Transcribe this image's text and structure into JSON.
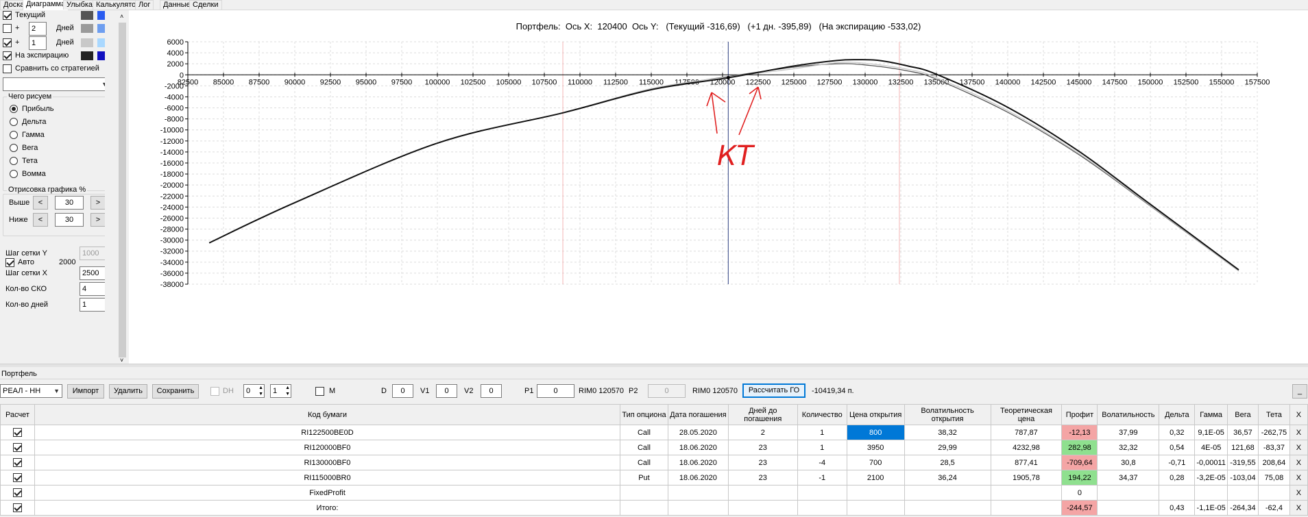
{
  "tabs": [
    "Доска",
    "Диаграмма",
    "Улыбка",
    "Калькулятор",
    "Лог",
    "Данные",
    "Сделки"
  ],
  "active_tab": 1,
  "left_panel": {
    "current": {
      "label": "Текущий",
      "checked": true,
      "color_dark": "#555555",
      "color_light": "#2a5cf0"
    },
    "plus_days_1": {
      "sign": "+",
      "value": "2",
      "unit": "Дней",
      "checked": false,
      "color_dark": "#9a9a9a",
      "color_light": "#6e9ef0"
    },
    "plus_days_2": {
      "sign": "+",
      "value": "1",
      "unit": "Дней",
      "checked": true,
      "color_dark": "#c8c8c8",
      "color_light": "#a9d8ff"
    },
    "expiry": {
      "label": "На экспирацию",
      "checked": true,
      "color_dark": "#222222",
      "color_light": "#1010c0"
    },
    "compare": {
      "label": "Сравнить со стратегией",
      "checked": false
    },
    "strategy_select": "",
    "what_draw": {
      "title": "Чего рисуем",
      "options": [
        "Прибыль",
        "Дельта",
        "Гамма",
        "Вега",
        "Тета",
        "Вомма"
      ],
      "selected": 0
    },
    "draw_pct": {
      "title": "Отрисовка графика %",
      "above_label": "Выше",
      "above_value": "30",
      "below_label": "Ниже",
      "below_value": "30",
      "prev": "<",
      "next": ">"
    },
    "grid_y": {
      "label": "Шаг сетки Y",
      "value": "1000"
    },
    "auto": {
      "label": "Авто",
      "checked": true,
      "value": "2000"
    },
    "grid_x": {
      "label": "Шаг сетки X",
      "value": "2500"
    },
    "sko": {
      "label": "Кол-во СКО",
      "value": "4"
    },
    "days": {
      "label": "Кол-во дней",
      "value": "1"
    }
  },
  "chart": {
    "title": "Портфель:  Ось X:  120400  Ось Y:   (Текущий -316,69)   (+1 дн. -395,89)   (На экспирацию -533,02)",
    "annotation": "КТ"
  },
  "chart_data": {
    "type": "line",
    "title": "Портфель:  Ось X:  120400  Ось Y:   (Текущий -316,69)   (+1 дн. -395,89)   (На экспирацию -533,02)",
    "xlabel": "",
    "ylabel": "",
    "xlim": [
      82500,
      157500
    ],
    "ylim": [
      -38000,
      6000
    ],
    "x_ticks": [
      82500,
      85000,
      87500,
      90000,
      92500,
      95000,
      97500,
      100000,
      102500,
      105000,
      107500,
      110000,
      112500,
      115000,
      117500,
      120000,
      122500,
      125000,
      127500,
      130000,
      132500,
      135000,
      137500,
      140000,
      142500,
      145000,
      147500,
      150000,
      152500,
      155000,
      157500
    ],
    "y_ticks": [
      6000,
      4000,
      2000,
      0,
      -2000,
      -4000,
      -6000,
      -8000,
      -10000,
      -12000,
      -14000,
      -16000,
      -18000,
      -20000,
      -22000,
      -24000,
      -26000,
      -28000,
      -30000,
      -32000,
      -34000,
      -36000,
      -38000
    ],
    "grid": true,
    "vertical_markers": [
      {
        "x": 108800,
        "color": "#f4b6b6"
      },
      {
        "x": 120400,
        "color": "#2c3e80"
      },
      {
        "x": 132400,
        "color": "#f4b6b6"
      }
    ],
    "series": [
      {
        "name": "Текущий",
        "color": "#555555",
        "x": [
          84000,
          90000,
          100000,
          108800,
          115000,
          120400,
          125000,
          128000,
          130000,
          133000,
          135000,
          140000,
          145000,
          150000,
          156200
        ],
        "y": [
          -30500,
          -23200,
          -12400,
          -6900,
          -2600,
          -317,
          1400,
          2000,
          1800,
          700,
          -800,
          -6800,
          -14500,
          -23800,
          -35600
        ]
      },
      {
        "name": "+1 дн.",
        "color": "#c8c8c8",
        "x": [
          84000,
          90000,
          100000,
          108800,
          115000,
          120400,
          125000,
          128000,
          130000,
          133000,
          135000,
          140000,
          145000,
          150000,
          156200
        ],
        "y": [
          -30500,
          -23200,
          -12400,
          -6900,
          -2500,
          -396,
          1100,
          2200,
          2100,
          1000,
          -500,
          -6500,
          -14300,
          -23700,
          -35600
        ]
      },
      {
        "name": "На экспирацию",
        "color": "#111111",
        "x": [
          84000,
          90000,
          100000,
          108800,
          115000,
          120400,
          125000,
          128000,
          129500,
          131000,
          133000,
          135000,
          140000,
          145000,
          150000,
          156200
        ],
        "y": [
          -30500,
          -23200,
          -12400,
          -6900,
          -2700,
          -533,
          1600,
          2600,
          2750,
          2600,
          1600,
          100,
          -5900,
          -13900,
          -23500,
          -35400
        ]
      }
    ]
  },
  "bottom": {
    "group_label": "Портфель",
    "portfolio_select": "РЕАЛ - НН",
    "import_btn": "Импорт",
    "delete_btn": "Удалить",
    "save_btn": "Сохранить",
    "dh_label": "DH",
    "spin1": "0",
    "spin2": "1",
    "m_label": "M",
    "d_label": "D",
    "d_value": "0",
    "v1_label": "V1",
    "v1_value": "0",
    "v2_label": "V2",
    "v2_value": "0",
    "p1_label": "P1",
    "p1_value": "0",
    "rim1": "RIM0 120570",
    "p2_label": "P2",
    "p2_value": "0",
    "rim2": "RIM0 120570",
    "go_btn": "Рассчитать ГО",
    "go_value": "-10419,34 п.",
    "min_btn": "_"
  },
  "table": {
    "headers": [
      "Расчет",
      "Код бумаги",
      "Тип опциона",
      "Дата погашения",
      "Дней до погашения",
      "Количество",
      "Цена открытия",
      "Волатильность открытия",
      "Теоретическая цена",
      "Профит",
      "Волатильность",
      "Дельта",
      "Гамма",
      "Вега",
      "Тета",
      "X"
    ],
    "rows": [
      {
        "checked": true,
        "code": "RI122500BE0D",
        "type": "Call",
        "date": "28.05.2020",
        "days": "2",
        "qty": "1",
        "open_price": "800",
        "open_vol": "38,32",
        "theo": "787,87",
        "profit": "-12,13",
        "vol": "37,99",
        "delta": "0,32",
        "gamma": "9,1E-05",
        "vega": "36,57",
        "theta": "-262,75",
        "x": "X"
      },
      {
        "checked": true,
        "code": "RI120000BF0",
        "type": "Call",
        "date": "18.06.2020",
        "days": "23",
        "qty": "1",
        "open_price": "3950",
        "open_vol": "29,99",
        "theo": "4232,98",
        "profit": "282,98",
        "vol": "32,32",
        "delta": "0,54",
        "gamma": "4E-05",
        "vega": "121,68",
        "theta": "-83,37",
        "x": "X"
      },
      {
        "checked": true,
        "code": "RI130000BF0",
        "type": "Call",
        "date": "18.06.2020",
        "days": "23",
        "qty": "-4",
        "open_price": "700",
        "open_vol": "28,5",
        "theo": "877,41",
        "profit": "-709,64",
        "vol": "30,8",
        "delta": "-0,71",
        "gamma": "-0,00011",
        "vega": "-319,55",
        "theta": "208,64",
        "x": "X"
      },
      {
        "checked": true,
        "code": "RI115000BR0",
        "type": "Put",
        "date": "18.06.2020",
        "days": "23",
        "qty": "-1",
        "open_price": "2100",
        "open_vol": "36,24",
        "theo": "1905,78",
        "profit": "194,22",
        "vol": "34,37",
        "delta": "0,28",
        "gamma": "-3,2E-05",
        "vega": "-103,04",
        "theta": "75,08",
        "x": "X"
      },
      {
        "checked": true,
        "code": "FixedProfit",
        "type": "",
        "date": "",
        "days": "",
        "qty": "",
        "open_price": "",
        "open_vol": "",
        "theo": "",
        "profit": "0",
        "vol": "",
        "delta": "",
        "gamma": "",
        "vega": "",
        "theta": "",
        "x": "X"
      },
      {
        "checked": true,
        "code": "Итого:",
        "type": "",
        "date": "",
        "days": "",
        "qty": "",
        "open_price": "",
        "open_vol": "",
        "theo": "",
        "profit": "-244,57",
        "vol": "",
        "delta": "0,43",
        "gamma": "-1,1E-05",
        "vega": "-264,34",
        "theta": "-62,4",
        "x": "X"
      }
    ]
  }
}
